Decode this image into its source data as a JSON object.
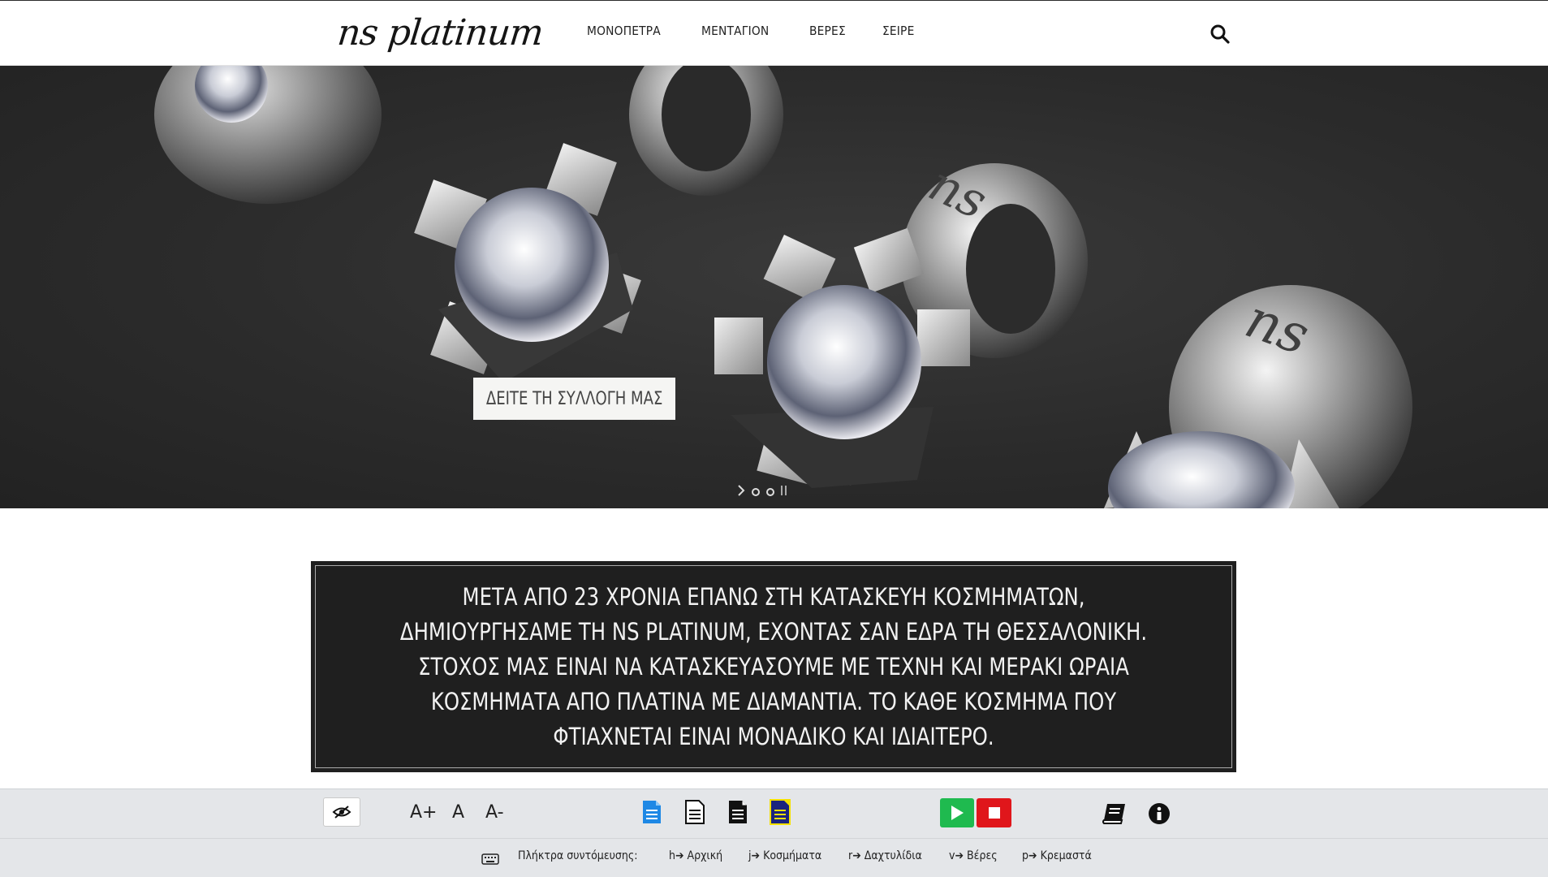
{
  "header": {
    "logo": "ns platinum",
    "nav": [
      "ΜΟΝΟΠΕΤΡΑ",
      "ΜΕΝΤΑΓΙΟΝ",
      "ΒΕΡΕΣ",
      "ΣΕΙΡΕ"
    ],
    "search_icon": "search-icon"
  },
  "hero": {
    "cta_label": "ΔΕΙΤΕ ΤΗ ΣΥΛΛΟΓΗ ΜΑΣ",
    "slider_controls": [
      "next-icon",
      "dot",
      "dot",
      "pause-icon"
    ]
  },
  "mission": {
    "text": "ΜΕΤΑ ΑΠΟ 23 ΧΡΟΝΙΑ ΕΠΑΝΩ ΣΤΗ ΚΑΤΑΣΚΕΥΗ ΚΟΣΜΗΜΑΤΩΝ, ΔΗΜΙΟΥΡΓΗΣΑΜΕ ΤΗ NS PLATINUM, ΕΧΟΝΤΑΣ ΣΑΝ ΕΔΡΑ ΤΗ ΘΕΣΣΑΛΟΝΙΚΗ. ΣΤΟΧΟΣ ΜΑΣ ΕΙΝΑΙ ΝΑ ΚΑΤΑΣΚΕΥΑΣΟΥΜΕ ΜΕ ΤΕΧΝΗ ΚΑΙ ΜΕΡΑΚΙ ΩΡΑΙΑ ΚΟΣΜΗΜΑΤΑ ΑΠΟ ΠΛΑΤΙΝΑ ΜΕ ΔΙΑΜΑΝΤΙΑ. ΤΟ ΚΑΘΕ ΚΟΣΜΗΜΑ ΠΟΥ ΦΤΙΑΧΝΕΤΑΙ ΕΙΝΑΙ ΜΟΝΑΔΙΚΟ ΚΑΙ ΙΔΙΑΙΤΕΡΟ."
  },
  "a11y": {
    "font_increase": "A+",
    "font_reset": "A",
    "font_decrease": "A-",
    "shortcuts_label": "Πλήκτρα συντόμευσης:",
    "shortcuts": [
      {
        "key": "h",
        "label": "Αρχική"
      },
      {
        "key": "j",
        "label": "Κοσμήματα"
      },
      {
        "key": "r",
        "label": "Δαχτυλίδια"
      },
      {
        "key": "v",
        "label": "Βέρες"
      },
      {
        "key": "p",
        "label": "Κρεμαστά"
      }
    ],
    "colors": {
      "play": "#1fba4f",
      "stop": "#e0161b",
      "doc_blue": "#1e88e5",
      "doc_navy": "#1a237e"
    }
  }
}
